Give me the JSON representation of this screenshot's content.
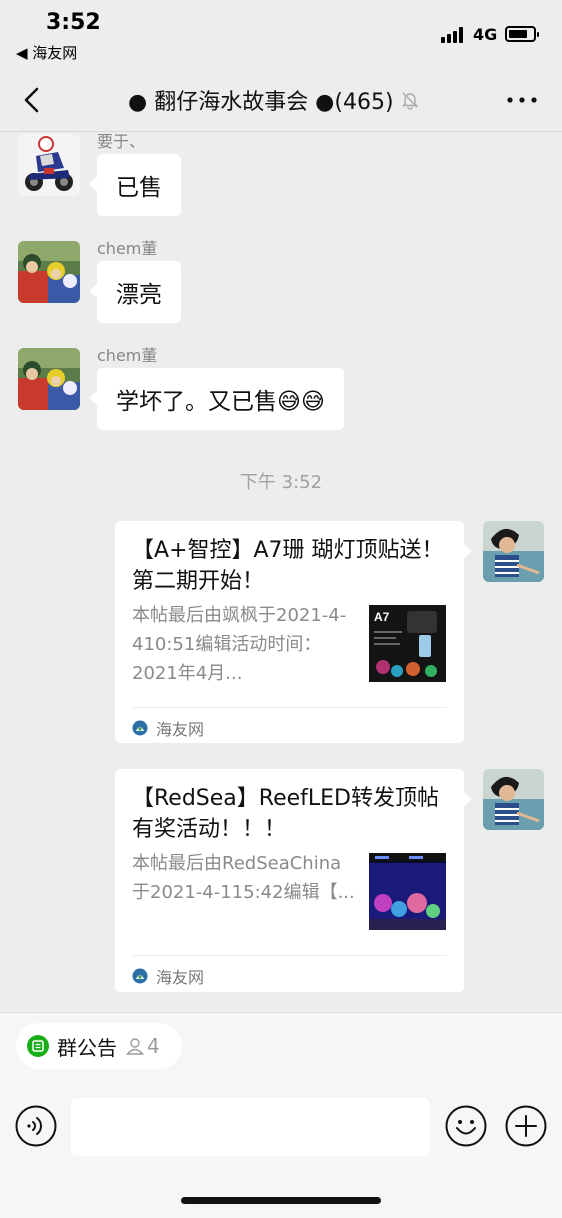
{
  "status_bar": {
    "time": "3:52",
    "back_app": "◀ 海友网",
    "network": "4G",
    "battery_level": 0.78
  },
  "nav": {
    "title": "● 翻仔海水故事会 ●(465)",
    "back_icon": "chevron-left-icon",
    "mute_icon": "bell-slash-icon",
    "more_icon": "ellipsis-icon"
  },
  "messages": [
    {
      "sender": "要于、",
      "text": "已售"
    },
    {
      "sender": "chem董",
      "text": "漂亮"
    },
    {
      "sender": "chem董",
      "text": "学坏了。又已售😅😅"
    }
  ],
  "timestamp": "下午 3:52",
  "cards": [
    {
      "title": "【A+智控】A7珊 瑚灯顶贴送！第二期开始！",
      "desc": "本帖最后由飒枫于2021-4-410:51编辑活动时间：2021年4月...",
      "source": "海友网"
    },
    {
      "title": "【RedSea】ReefLED转发顶帖有奖活动！！！",
      "desc": "本帖最后由RedSeaChina于2021-4-115:42编辑【...",
      "source": "海友网"
    }
  ],
  "thumb_a7_label": "A7",
  "bottom": {
    "notice_label": "群公告",
    "notice_count": "4",
    "input_placeholder": ""
  },
  "colors": {
    "background": "#ededed",
    "bubble": "#ffffff",
    "accent_green": "#1aad19"
  }
}
